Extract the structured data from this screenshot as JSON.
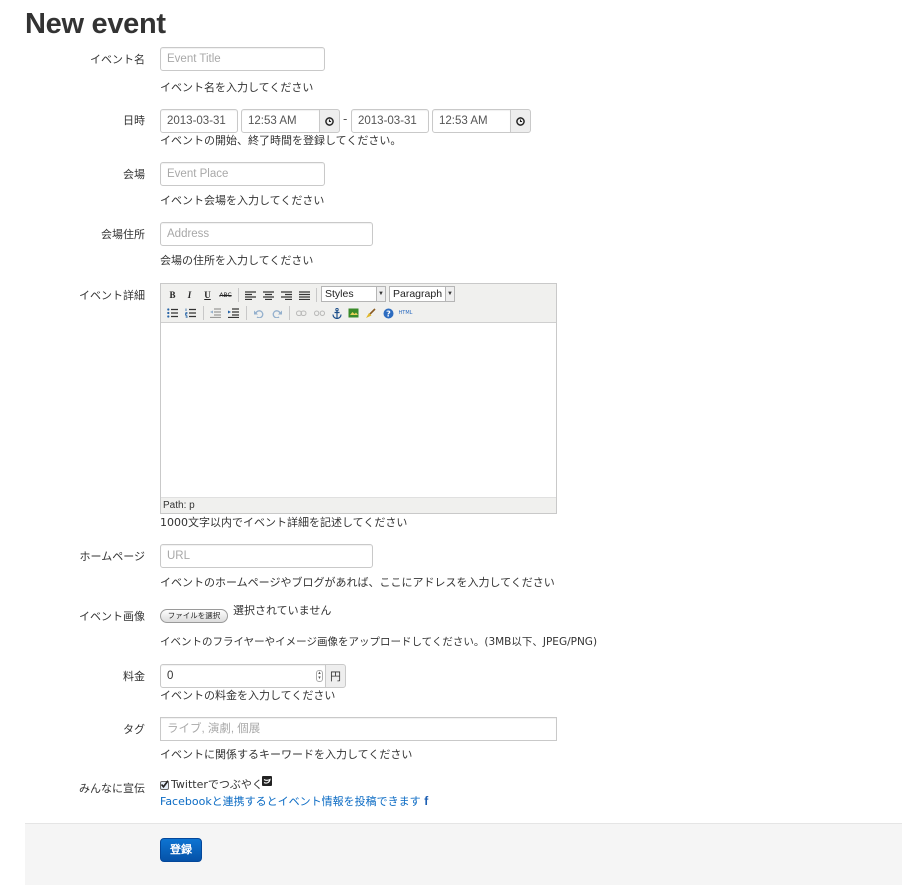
{
  "page": {
    "title": "New event"
  },
  "fields": {
    "name": {
      "label": "イベント名",
      "placeholder": "Event Title",
      "help": "イベント名を入力してください"
    },
    "datetime": {
      "label": "日時",
      "start_date": "2013-03-31",
      "start_time": "12:53 AM",
      "separator": "-",
      "end_date": "2013-03-31",
      "end_time": "12:53 AM",
      "help": "イベントの開始、終了時間を登録してください。"
    },
    "place": {
      "label": "会場",
      "placeholder": "Event Place",
      "help": "イベント会場を入力してください"
    },
    "address": {
      "label": "会場住所",
      "placeholder": "Address",
      "help": "会場の住所を入力してください"
    },
    "detail": {
      "label": "イベント詳細",
      "styles_select": "Styles",
      "format_select": "Paragraph",
      "path": "Path: p",
      "help": "1000文字以内でイベント詳細を記述してください"
    },
    "homepage": {
      "label": "ホームページ",
      "placeholder": "URL",
      "help": "イベントのホームページやブログがあれば、ここにアドレスを入力してください"
    },
    "image": {
      "label": "イベント画像",
      "button": "ファイルを選択",
      "status": "選択されていません",
      "help": "イベントのフライヤーやイメージ画像をアップロードしてください。(3MB以下、JPEG/PNG)"
    },
    "fee": {
      "label": "料金",
      "value": "0",
      "unit": "円",
      "help": "イベントの料金を入力してください"
    },
    "tags": {
      "label": "タグ",
      "placeholder": "ライブ, 演劇, 個展",
      "help": "イベントに関係するキーワードを入力してください"
    },
    "promote": {
      "label": "みんなに宣伝",
      "twitter_label": "Twitterでつぶやく",
      "twitter_checked": true,
      "facebook_link": "Facebookと連携するとイベント情報を投稿できます"
    }
  },
  "editor_toolbar": {
    "row1": [
      "bold-icon",
      "italic-icon",
      "underline-icon",
      "strikethrough-icon",
      "align-left-icon",
      "align-center-icon",
      "align-right-icon",
      "align-justify-icon"
    ],
    "row2": [
      "bullet-list-icon",
      "numbered-list-icon",
      "outdent-icon",
      "indent-icon",
      "undo-icon",
      "redo-icon",
      "link-icon",
      "unlink-icon",
      "anchor-icon",
      "image-icon",
      "cleanup-icon",
      "help-icon",
      "html-icon"
    ]
  },
  "actions": {
    "submit": "登録"
  },
  "colors": {
    "submit_bg": "#0b62c4",
    "link": "#0b6bc4"
  }
}
